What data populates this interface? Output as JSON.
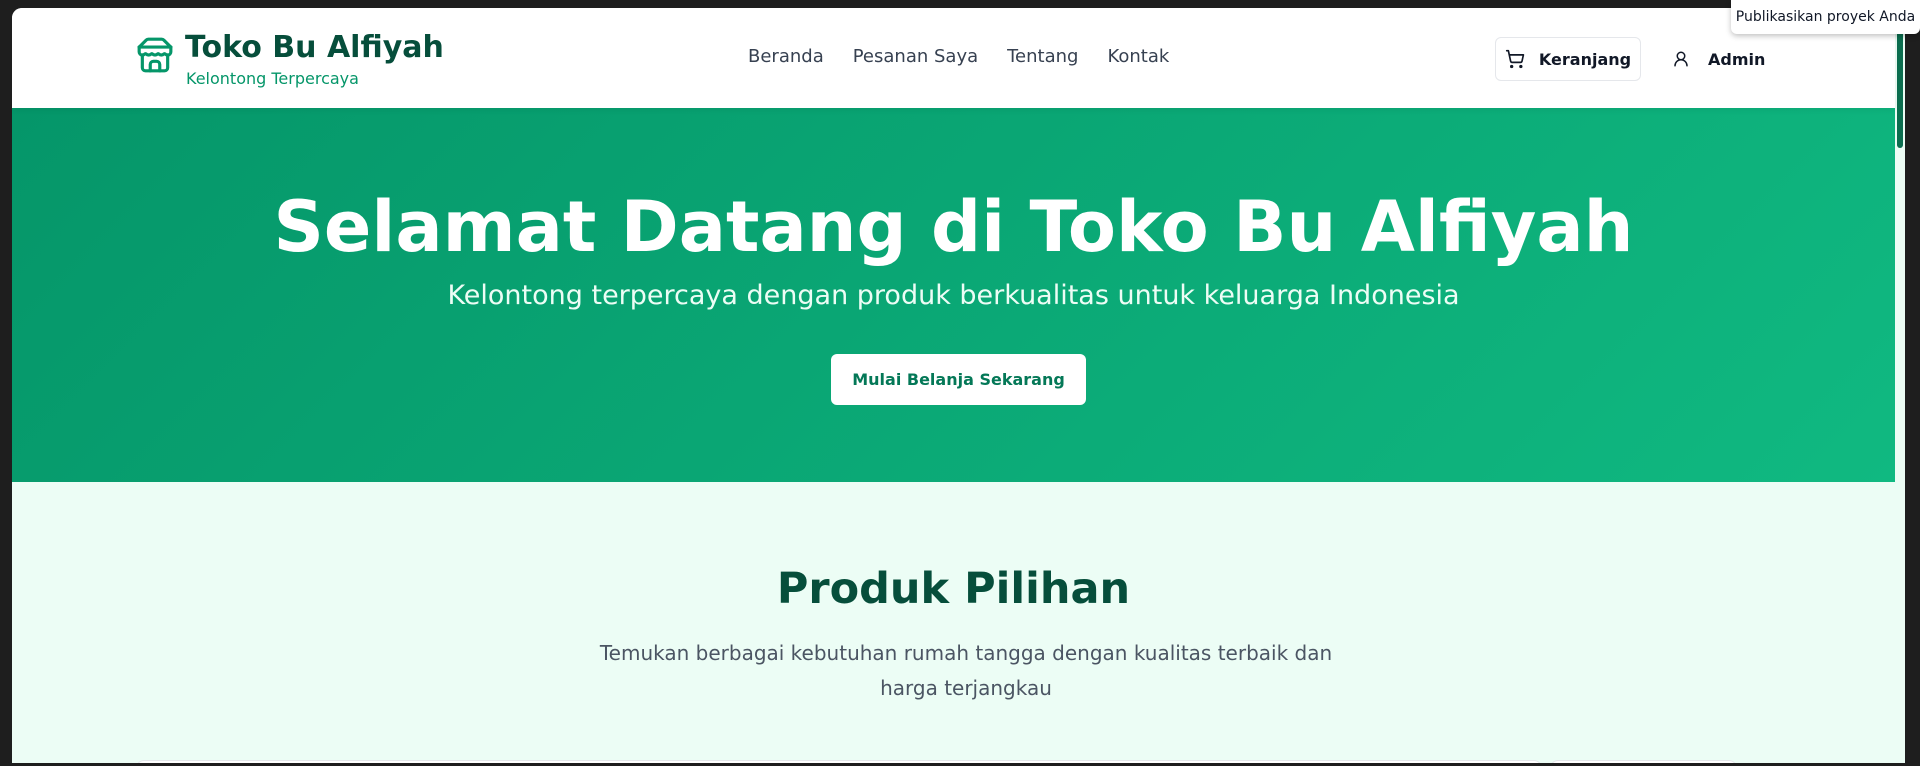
{
  "colors": {
    "brand_dark": "#064e3b",
    "brand_green": "#059669",
    "hero_gradient_start": "#059669",
    "hero_gradient_end": "#10b981",
    "section_bg": "#ecfdf5"
  },
  "header": {
    "brand_name": "Toko Bu Alfiyah",
    "brand_tagline": "Kelontong Terpercaya",
    "logo_icon": "store-icon",
    "nav": [
      {
        "label": "Beranda"
      },
      {
        "label": "Pesanan Saya"
      },
      {
        "label": "Tentang"
      },
      {
        "label": "Kontak"
      }
    ],
    "cart": {
      "label": "Keranjang",
      "icon": "cart-icon"
    },
    "user": {
      "label": "Admin",
      "icon": "user-icon"
    }
  },
  "hero": {
    "title": "Selamat Datang di Toko Bu Alfiyah",
    "subtitle": "Kelontong terpercaya dengan produk berkualitas untuk keluarga Indonesia",
    "cta_label": "Mulai Belanja Sekarang"
  },
  "products": {
    "title": "Produk Pilihan",
    "subtitle": "Temukan berbagai kebutuhan rumah tangga dengan kualitas terbaik dan harga terjangkau"
  },
  "overlay": {
    "publish_label": "Publikasikan proyek Anda"
  }
}
